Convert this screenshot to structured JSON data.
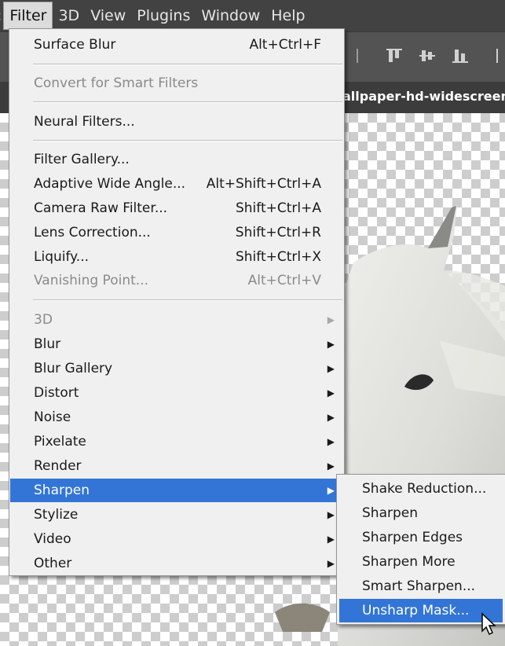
{
  "menubar": {
    "items": [
      {
        "label": "Filter",
        "active": true
      },
      {
        "label": "3D"
      },
      {
        "label": "View"
      },
      {
        "label": "Plugins"
      },
      {
        "label": "Window"
      },
      {
        "label": "Help"
      }
    ]
  },
  "document": {
    "tab_title": "allpaper-hd-widescreen,"
  },
  "filter_menu": {
    "surface_blur": {
      "label": "Surface Blur",
      "shortcut": "Alt+Ctrl+F"
    },
    "convert_smart": {
      "label": "Convert for Smart Filters"
    },
    "neural_filters": {
      "label": "Neural Filters..."
    },
    "filter_gallery": {
      "label": "Filter Gallery..."
    },
    "adaptive_wide": {
      "label": "Adaptive Wide Angle...",
      "shortcut": "Alt+Shift+Ctrl+A"
    },
    "camera_raw": {
      "label": "Camera Raw Filter...",
      "shortcut": "Shift+Ctrl+A"
    },
    "lens_correction": {
      "label": "Lens Correction...",
      "shortcut": "Shift+Ctrl+R"
    },
    "liquify": {
      "label": "Liquify...",
      "shortcut": "Shift+Ctrl+X"
    },
    "vanishing_point": {
      "label": "Vanishing Point...",
      "shortcut": "Alt+Ctrl+V"
    },
    "categories": {
      "3d": "3D",
      "blur": "Blur",
      "blur_gallery": "Blur Gallery",
      "distort": "Distort",
      "noise": "Noise",
      "pixelate": "Pixelate",
      "render": "Render",
      "sharpen": "Sharpen",
      "stylize": "Stylize",
      "video": "Video",
      "other": "Other"
    },
    "arrow_glyph": "▶"
  },
  "sharpen_submenu": {
    "shake_reduction": "Shake Reduction...",
    "sharpen": "Sharpen",
    "sharpen_edges": "Sharpen Edges",
    "sharpen_more": "Sharpen More",
    "smart_sharpen": "Smart Sharpen...",
    "unsharp_mask": "Unsharp Mask..."
  },
  "colors": {
    "highlight": "#3275d6",
    "menu_bg": "#f0f0f0",
    "menubar_bg": "#424242"
  }
}
